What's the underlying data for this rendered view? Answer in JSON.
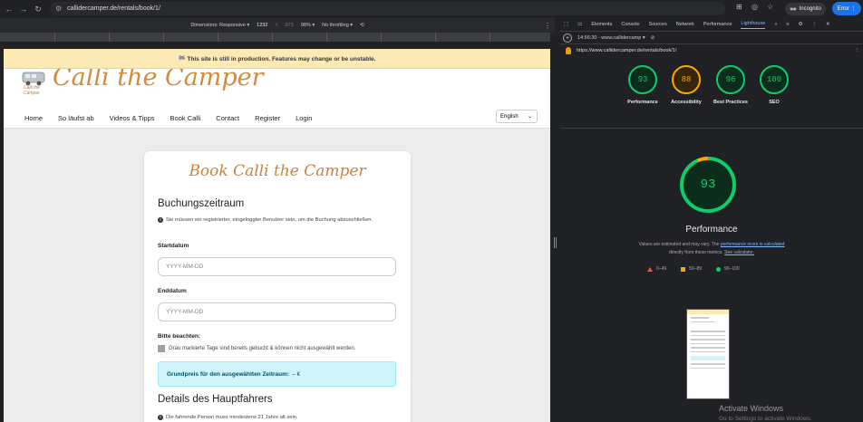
{
  "browser": {
    "url": "callidercamper.de/rentals/book/1/",
    "incognito_label": "Incognito",
    "error_label": "Error"
  },
  "device_toolbar": {
    "dimensions_label": "Dimensions: Responsive ▾",
    "width": "1232",
    "height": "875",
    "zoom": "98% ▾",
    "throttling": "No throttling ▾"
  },
  "page": {
    "banner": "🏁 This site is still in production. Features may change or be unstable.",
    "logo_caption": "Calli the Camper",
    "logo_title": "Calli the Camper",
    "menu": [
      "Home",
      "So läufst ab",
      "Videos & Tipps",
      "Book Calli",
      "Contact",
      "Register",
      "Login"
    ],
    "language": "English",
    "card": {
      "title": "Book Calli the Camper",
      "section1": "Buchungszeitraum",
      "login_info": "Sie müssen ein registrierter, eingeloggter Benutzer sein, um die Buchung abzuschließen.",
      "start_label": "Startdatum",
      "start_placeholder": "YYYY-MM-DD",
      "end_label": "Enddatum",
      "end_placeholder": "YYYY-MM-DD",
      "note_label": "Bitte beachten:",
      "note_text": "Grau markierte Tage sind bereits gebucht & können nicht ausgewählt werden.",
      "price_label": "Grundpreis für den ausgewählten Zeitraum:",
      "price_value": "– €",
      "section2": "Details des Hauptfahrers",
      "driver_info": "Die fahrende Person muss mindestens 21 Jahre alt sein."
    }
  },
  "devtools": {
    "tabs": [
      "Elements",
      "Console",
      "Sources",
      "Network",
      "Performance",
      "Lighthouse"
    ],
    "selected_tab": "Lighthouse",
    "report_time": "14:56:30 - www.callidercamp ▾",
    "report_url": "https://www.callidercamper.de/rentals/book/1/",
    "scores": [
      {
        "label": "Performance",
        "value": "93",
        "color": "#0cce6b"
      },
      {
        "label": "Accessibility",
        "value": "88",
        "color": "#ffa400"
      },
      {
        "label": "Best Practices",
        "value": "96",
        "color": "#0cce6b"
      },
      {
        "label": "SEO",
        "value": "100",
        "color": "#0cce6b"
      }
    ],
    "perf_score": "93",
    "perf_title": "Performance",
    "perf_desc_1": "Values are estimated and may vary. The",
    "perf_desc_link1": "performance score is calculated",
    "perf_desc_2": "directly from these metrics.",
    "perf_desc_link2": "See calculator.",
    "ranges": [
      "0–49",
      "50–89",
      "90–100"
    ],
    "watermark_title": "Activate Windows",
    "watermark_sub": "Go to Settings to activate Windows."
  }
}
